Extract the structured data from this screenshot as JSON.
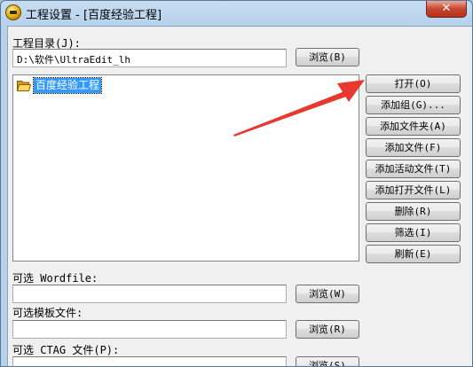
{
  "window": {
    "title": "工程设置 - [百度经验工程]",
    "close_glyph": "✕"
  },
  "project_dir": {
    "label": "工程目录(J):",
    "value": "D:\\软件\\UltraEdit_lh",
    "browse_label": "浏览(B)"
  },
  "tree": {
    "items": [
      {
        "label": "百度经验工程",
        "icon": "folder-open-icon",
        "selected": true
      }
    ]
  },
  "side_buttons": [
    {
      "label": "打开(O)"
    },
    {
      "label": "添加组(G)..."
    },
    {
      "label": "添加文件夹(A)"
    },
    {
      "label": "添加文件(F)"
    },
    {
      "label": "添加活动文件(T)"
    },
    {
      "label": "添加打开文件(L)"
    },
    {
      "label": "删除(R)"
    },
    {
      "label": "筛选(I)"
    },
    {
      "label": "刷新(E)"
    }
  ],
  "wordfile": {
    "label": "可选 Wordfile:",
    "value": "",
    "browse_label": "浏览(W)"
  },
  "template": {
    "label": "可选模板文件:",
    "value": "",
    "browse_label": "浏览(R)"
  },
  "ctag": {
    "label": "可选 CTAG 文件(P):",
    "value": "",
    "browse_label": "浏览(S)"
  },
  "colors": {
    "annotation_arrow": "#e8392f",
    "selection": "#3399ff"
  }
}
